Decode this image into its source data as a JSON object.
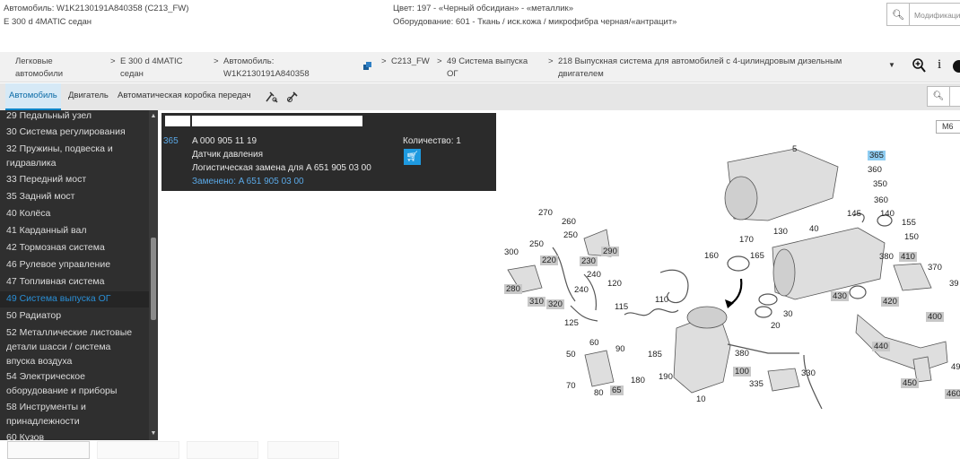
{
  "header": {
    "vehicle_line": "Автомобиль: W1K2130191A840358 (C213_FW)",
    "model_line": "E 300 d 4MATIC седан",
    "color_line": "Цвет: 197 - «Черный обсидиан» - «металлик»",
    "equipment_line": "Оборудование: 601 - Ткань / иск.кожа / микрофибра черная/«антрацит»",
    "search_placeholder": "Модификация"
  },
  "breadcrumbs": [
    {
      "l1": "Легковые",
      "l2": "автомобили"
    },
    {
      "l1": "E 300 d 4MATIC",
      "l2": "седан"
    },
    {
      "l1": "Автомобиль:",
      "l2": "W1K2130191A840358"
    },
    {
      "l1": "C213_FW",
      "l2": ""
    },
    {
      "l1": "49 Система выпуска",
      "l2": "ОГ"
    },
    {
      "l1": "218 Выпускная система для автомобилей с 4-цилиндровым дизельным",
      "l2": "двигателем"
    }
  ],
  "tabs": {
    "car": "Автомобиль",
    "engine": "Двигатель",
    "gearbox": "Автоматическая коробка передач"
  },
  "sidebar": {
    "items": [
      {
        "label": "29 Педальный узел"
      },
      {
        "label": "30 Система регулирования"
      },
      {
        "label": "32 Пружины, подвеска и",
        "label2": "гидравлика"
      },
      {
        "label": "33 Передний мост"
      },
      {
        "label": "35 Задний мост"
      },
      {
        "label": "40 Колёса"
      },
      {
        "label": "41 Карданный вал"
      },
      {
        "label": "42 Тормозная система"
      },
      {
        "label": "46 Рулевое управление"
      },
      {
        "label": "47 Топливная система"
      },
      {
        "label": "49 Система выпуска ОГ",
        "active": true
      },
      {
        "label": "50 Радиатор"
      },
      {
        "label": "52 Металлические листовые",
        "label2": "детали шасси / система",
        "label3": "впуска воздуха"
      },
      {
        "label": "54 Электрическое",
        "label2": "оборудование и приборы"
      },
      {
        "label": "58 Инструменты и",
        "label2": "принадлежности"
      },
      {
        "label": "60 Кузов"
      }
    ]
  },
  "popup": {
    "position": "365",
    "part_number": "A 000 905 11 19",
    "name": "Датчик давления",
    "replacement": "Логистическая замена для A 651 905 03 00",
    "replaced": "Заменено: A 651 905 03 00",
    "quantity": "Количество: 1"
  },
  "diagram": {
    "zoom_label": "M6",
    "labels": [
      {
        "t": "5",
        "s": ""
      },
      {
        "t": "365",
        "s": "hl"
      },
      {
        "t": "360",
        "s": ""
      },
      {
        "t": "350",
        "s": ""
      },
      {
        "t": "360",
        "s": ""
      },
      {
        "t": "145",
        "s": ""
      },
      {
        "t": "140",
        "s": ""
      },
      {
        "t": "155",
        "s": ""
      },
      {
        "t": "150",
        "s": ""
      },
      {
        "t": "270",
        "s": ""
      },
      {
        "t": "260",
        "s": ""
      },
      {
        "t": "250",
        "s": ""
      },
      {
        "t": "250",
        "s": ""
      },
      {
        "t": "290",
        "s": "box"
      },
      {
        "t": "300",
        "s": ""
      },
      {
        "t": "220",
        "s": "box"
      },
      {
        "t": "230",
        "s": "box"
      },
      {
        "t": "240",
        "s": ""
      },
      {
        "t": "240",
        "s": ""
      },
      {
        "t": "120",
        "s": ""
      },
      {
        "t": "280",
        "s": "box"
      },
      {
        "t": "310",
        "s": "box"
      },
      {
        "t": "320",
        "s": "box"
      },
      {
        "t": "110",
        "s": ""
      },
      {
        "t": "115",
        "s": ""
      },
      {
        "t": "125",
        "s": ""
      },
      {
        "t": "170",
        "s": ""
      },
      {
        "t": "130",
        "s": ""
      },
      {
        "t": "40",
        "s": ""
      },
      {
        "t": "160",
        "s": ""
      },
      {
        "t": "165",
        "s": ""
      },
      {
        "t": "380",
        "s": ""
      },
      {
        "t": "410",
        "s": "box"
      },
      {
        "t": "370",
        "s": ""
      },
      {
        "t": "39",
        "s": ""
      },
      {
        "t": "430",
        "s": "box"
      },
      {
        "t": "420",
        "s": "box"
      },
      {
        "t": "400",
        "s": "box"
      },
      {
        "t": "30",
        "s": ""
      },
      {
        "t": "20",
        "s": ""
      },
      {
        "t": "60",
        "s": ""
      },
      {
        "t": "90",
        "s": ""
      },
      {
        "t": "50",
        "s": ""
      },
      {
        "t": "185",
        "s": ""
      },
      {
        "t": "380",
        "s": ""
      },
      {
        "t": "100",
        "s": "box"
      },
      {
        "t": "190",
        "s": ""
      },
      {
        "t": "180",
        "s": ""
      },
      {
        "t": "70",
        "s": ""
      },
      {
        "t": "80",
        "s": ""
      },
      {
        "t": "65",
        "s": "box"
      },
      {
        "t": "330",
        "s": ""
      },
      {
        "t": "335",
        "s": ""
      },
      {
        "t": "10",
        "s": ""
      },
      {
        "t": "440",
        "s": "box"
      },
      {
        "t": "450",
        "s": "box"
      },
      {
        "t": "460",
        "s": "box"
      },
      {
        "t": "49",
        "s": ""
      }
    ]
  }
}
